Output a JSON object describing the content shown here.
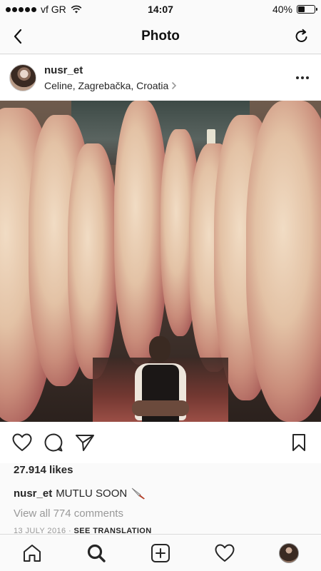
{
  "status_bar": {
    "carrier": "vf GR",
    "time": "14:07",
    "battery_percent": "40%",
    "battery_level": 0.4
  },
  "nav": {
    "title": "Photo",
    "back_icon": "chevron-left-icon",
    "refresh_icon": "refresh-icon"
  },
  "post": {
    "username": "nusr_et",
    "location": "Celine, Zagrebačka, Croatia",
    "likes": "27.914 likes",
    "caption_user": "nusr_et",
    "caption_text": "MUTLU SOON",
    "view_comments": "View all 774 comments",
    "date": "13 JULY 2016",
    "separator": "·",
    "see_translation": "SEE TRANSLATION"
  },
  "actions": [
    "heart-icon",
    "comment-icon",
    "share-icon",
    "bookmark-icon"
  ],
  "tab_bar": [
    "home-icon",
    "search-icon",
    "add-post-icon",
    "activity-heart-icon",
    "profile-avatar"
  ]
}
